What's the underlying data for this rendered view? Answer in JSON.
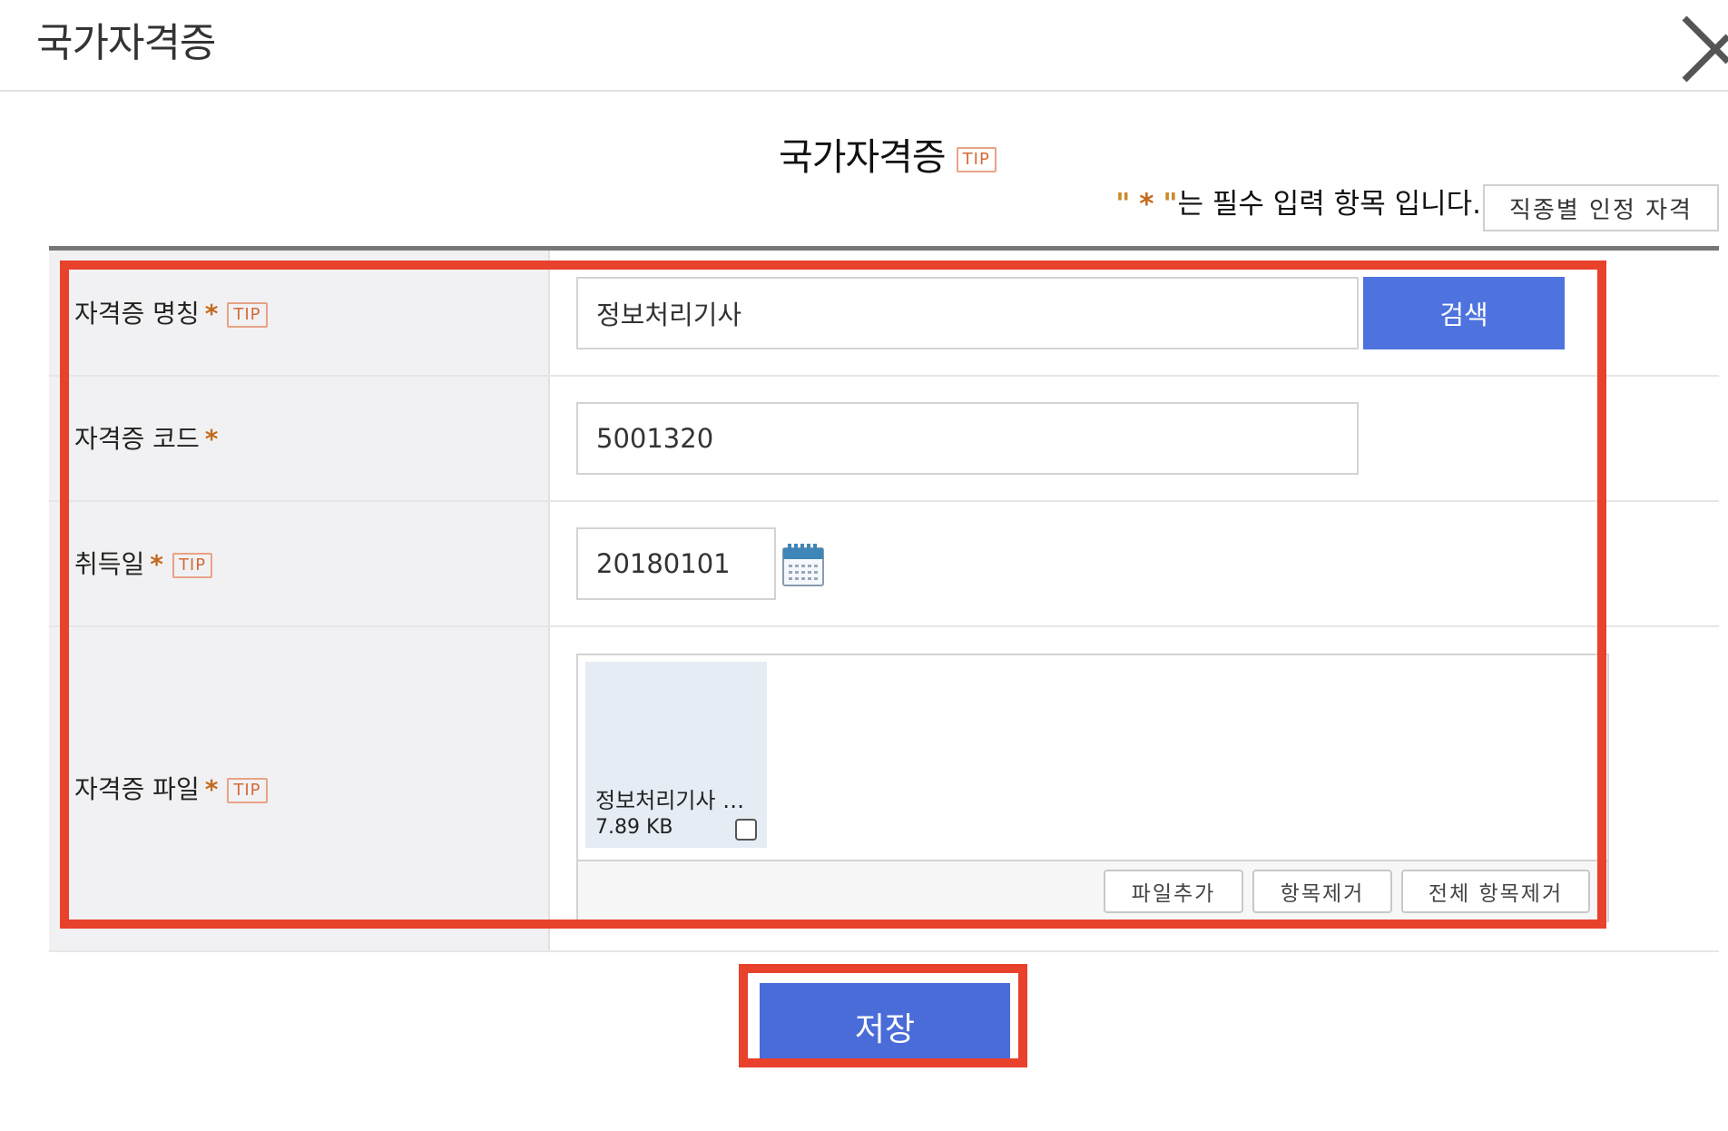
{
  "dialog": {
    "title": "국가자격증",
    "close_icon": "close-icon"
  },
  "section": {
    "title": "국가자격증",
    "tip": "TIP"
  },
  "required_note": {
    "open_quote": "\"",
    "star": "*",
    "close_quote": "\"",
    "text": "는 필수 입력 항목 입니다."
  },
  "job_button": "직종별 인정 자격",
  "form": {
    "cert_name": {
      "label": "자격증 명칭",
      "star": "*",
      "tip": "TIP",
      "value": "정보처리기사",
      "search_label": "검색"
    },
    "cert_code": {
      "label": "자격증 코드",
      "star": "*",
      "value": "5001320"
    },
    "acquired_date": {
      "label": "취득일",
      "star": "*",
      "tip": "TIP",
      "value": "20180101",
      "calendar_icon": "calendar-icon"
    },
    "cert_file": {
      "label": "자격증 파일",
      "star": "*",
      "tip": "TIP",
      "file": {
        "name": "정보처리기사 …",
        "size": "7.89 KB",
        "selected": false
      },
      "buttons": {
        "add": "파일추가",
        "remove": "항목제거",
        "remove_all": "전체 항목제거"
      }
    }
  },
  "save_label": "저장",
  "colors": {
    "primary": "#4e73df",
    "required": "#c46a1e",
    "highlight": "#e8412c"
  }
}
